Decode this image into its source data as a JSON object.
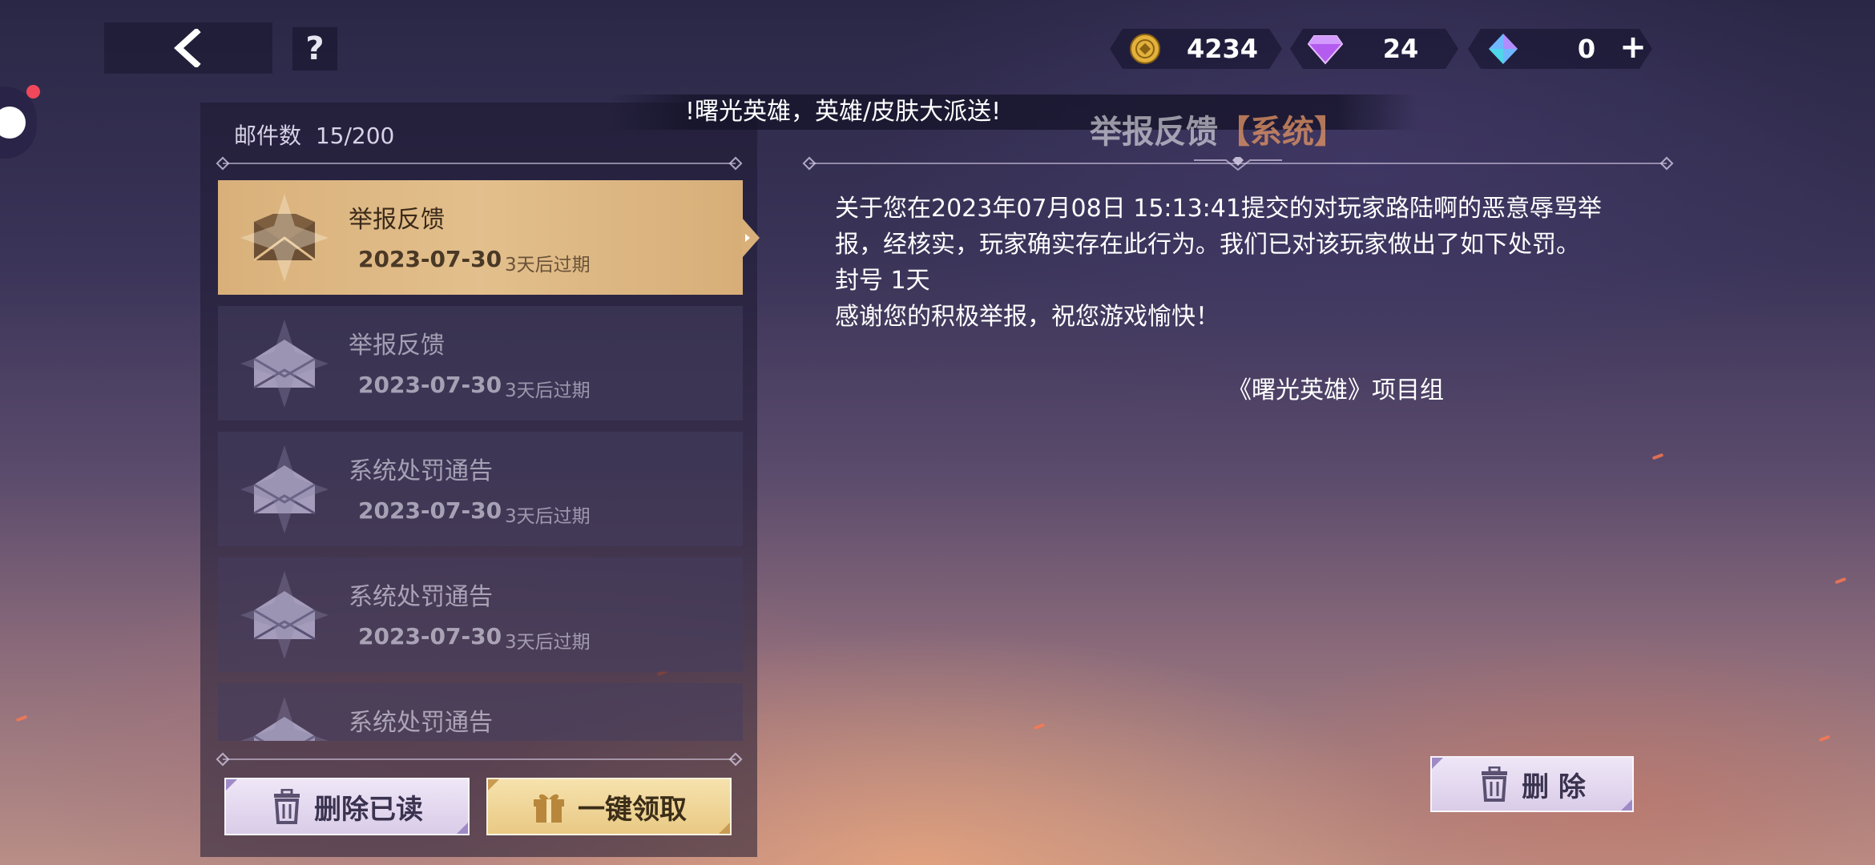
{
  "header": {
    "back_icon": "chevron-left-icon",
    "help_label": "?"
  },
  "currencies": [
    {
      "icon": "gold-coin-icon",
      "value": "4234",
      "color": "#e3b13c"
    },
    {
      "icon": "purple-diamond-icon",
      "value": "24",
      "color": "#b45cf0"
    },
    {
      "icon": "blue-crystal-icon",
      "value": "0",
      "color": "#6fb8ff"
    }
  ],
  "plus_label": "+",
  "banner_text": "!曙光英雄，英雄/皮肤大派送!",
  "mailbox": {
    "count_label": "邮件数",
    "count_value": "15/200",
    "items": [
      {
        "title": "举报反馈",
        "date": "2023-07-30",
        "expire": "3天后过期"
      },
      {
        "title": "举报反馈",
        "date": "2023-07-30",
        "expire": "3天后过期"
      },
      {
        "title": "系统处罚通告",
        "date": "2023-07-30",
        "expire": "3天后过期"
      },
      {
        "title": "系统处罚通告",
        "date": "2023-07-30",
        "expire": "3天后过期"
      },
      {
        "title": "系统处罚通告",
        "date": "",
        "expire": ""
      }
    ],
    "selected_index": 0,
    "delete_read_label": "删除已读",
    "claim_all_label": "一键领取"
  },
  "detail": {
    "title": "举报反馈",
    "tag": "【系统】",
    "lines": [
      "关于您在2023年07月08日 15:13:41提交的对玩家路陆啊的恶意辱骂举",
      "报，经核实，玩家确实存在此行为。我们已对该玩家做出了如下处罚。",
      "封号 1天",
      "感谢您的积极举报，祝您游戏愉快！"
    ],
    "signature": "《曙光英雄》项目组",
    "delete_label": "删 除"
  },
  "colors": {
    "selected_mail": "#e2bf8c",
    "gold_button": "#f2d99c",
    "light_button": "#e6dcf0",
    "notification_dot": "#f0485a"
  }
}
